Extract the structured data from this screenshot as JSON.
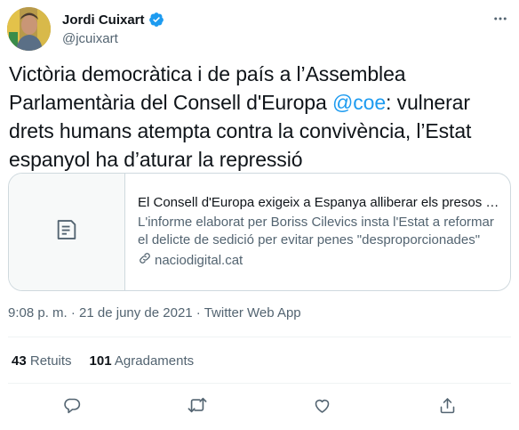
{
  "author": {
    "display_name": "Jordi Cuixart",
    "handle": "@jcuixart",
    "verified": true
  },
  "tweet": {
    "text_before": "Victòria democràtica i de país a l’Assemblea Parlamentària del Consell d'Europa ",
    "mention": "@coe",
    "text_after": ": vulnerar drets humans atempta contra la convivència, l’Estat espanyol ha d’aturar la repressió"
  },
  "card": {
    "title": "El Consell d'Europa exigeix a Espanya alliberar els presos i re...",
    "description": "L'informe elaborat per Boriss Cilevics insta l'Estat a reformar el delicte de sedició per evitar penes \"desproporcionades\"",
    "domain": "naciodigital.cat"
  },
  "meta": {
    "line": "9:08 p. m. · 21 de juny de 2021 · Twitter Web App"
  },
  "stats": {
    "retweets_count": "43",
    "retweets_label": "Retuits",
    "likes_count": "101",
    "likes_label": "Agradaments"
  },
  "icons": {
    "reply": "reply-icon",
    "retweet": "retweet-icon",
    "like": "heart-icon",
    "share": "share-icon"
  },
  "colors": {
    "accent": "#1d9bf0",
    "text": "#0f1419",
    "secondary": "#536471",
    "border": "#cfd9de"
  }
}
